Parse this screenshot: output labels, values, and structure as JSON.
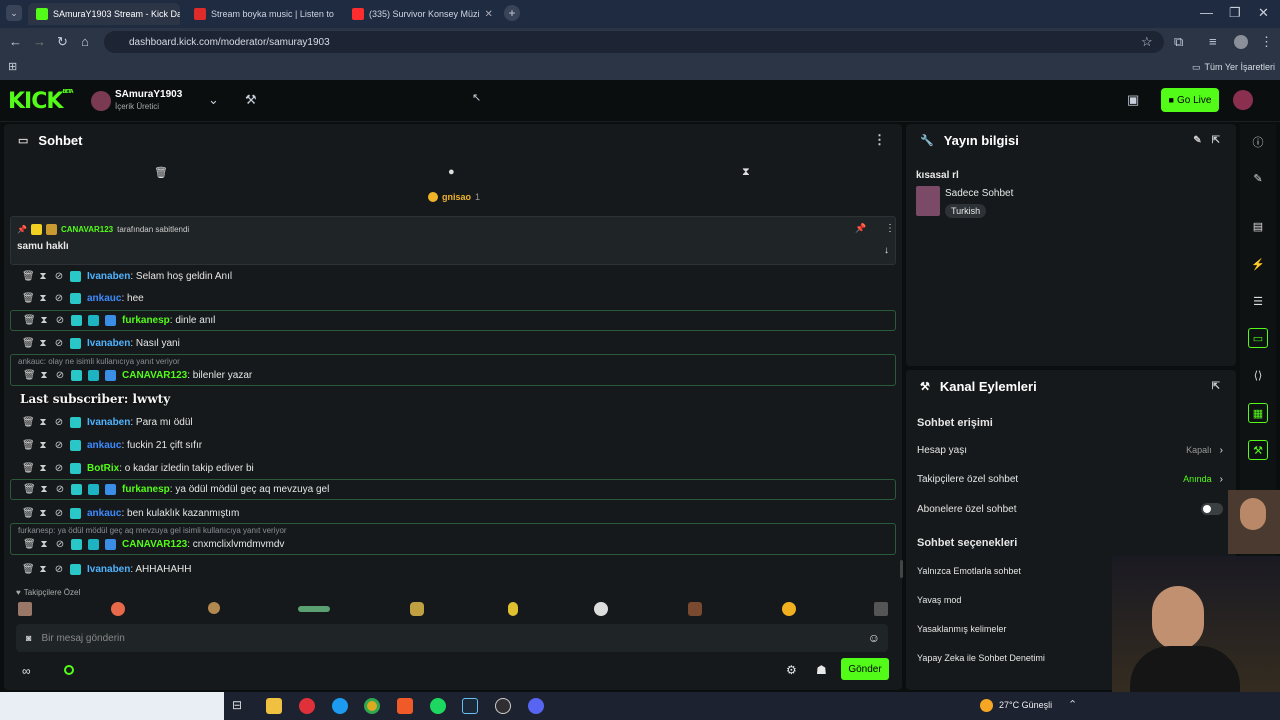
{
  "browser": {
    "tabs": [
      {
        "title": "SAmuraY1903 Stream - Kick Da",
        "color": "#53fc18"
      },
      {
        "title": "Stream boyka music | Listen to",
        "color": "#e02b2b"
      },
      {
        "title": "(335) Survivor Konsey Müzi",
        "color": "#ff2d2d"
      }
    ],
    "url": "dashboard.kick.com/moderator/samuray1903",
    "bookmarks_label": "Tüm Yer İşaretleri"
  },
  "header": {
    "logo": "KICK",
    "beta": "BETA",
    "username": "SAmuraY1903",
    "role": "İçerik Üretici",
    "golive_label": "Go Live"
  },
  "chat": {
    "title": "Sohbet",
    "top_user": "gnisao",
    "top_count": "1",
    "pinned": {
      "by": "CANAVAR123",
      "by_suffix": "tarafından sabitlendi",
      "text": "samu haklı"
    },
    "messages": [
      {
        "user": "Ivanaben",
        "text": ": Selam hoş geldin Anıl",
        "color": "#4fb3ff",
        "hl": false
      },
      {
        "user": "ankauc",
        "text": ": hee",
        "color": "#3d8bff",
        "hl": false
      },
      {
        "user": "furkanesp",
        "text": ": dinle anıl",
        "color": "#53fc18",
        "hl": true
      },
      {
        "user": "Ivanaben",
        "text": ": Nasıl yani",
        "color": "#4fb3ff",
        "hl": false
      },
      {
        "user": "CANAVAR123",
        "text": ": bilenler yazar",
        "color": "#53fc18",
        "hl": true,
        "reply": "ankauc: olay ne isimli kullanıcıya yanıt veriyor"
      },
      {
        "user": "Ivanaben",
        "text": ": Para mı ödül",
        "color": "#4fb3ff",
        "hl": false
      },
      {
        "user": "ankauc",
        "text": ": fuckin 21 çift sıfır",
        "color": "#3d8bff",
        "hl": false
      },
      {
        "user": "BotRix",
        "text": ": o kadar izledin takip ediver bi",
        "color": "#53fc18",
        "hl": false
      },
      {
        "user": "furkanesp",
        "text": ": ya ödül mödül geç aq mevzuya gel",
        "color": "#53fc18",
        "hl": true
      },
      {
        "user": "ankauc",
        "text": ": ben kulaklık kazanmıştım",
        "color": "#3d8bff",
        "hl": false
      },
      {
        "user": "CANAVAR123",
        "text": ": cnxmclixlvmdmvmdv",
        "color": "#53fc18",
        "hl": true,
        "reply": "furkanesp: ya ödül mödül geç aq mevzuya gel isimli kullanıcıya yanıt veriyor"
      },
      {
        "user": "Ivanaben",
        "text": ": AHHAHAHH",
        "color": "#4fb3ff",
        "hl": false
      }
    ],
    "overlay_text": "Last subscriber: lwwty",
    "followers_only": "Takipçilere Özel",
    "input_placeholder": "Bir mesaj gönderin",
    "send_label": "Gönder"
  },
  "stream_info": {
    "title": "Yayın bilgisi",
    "stream_title": "kısasal rl",
    "category": "Sadece Sohbet",
    "language": "Turkish"
  },
  "channel_actions": {
    "title": "Kanal Eylemleri",
    "section1": "Sohbet erişimi",
    "rows": [
      {
        "label": "Hesap yaşı",
        "value": "Kapalı"
      },
      {
        "label": "Takipçilere özel sohbet",
        "value": "Anında"
      },
      {
        "label": "Abonelere özel sohbet",
        "value": ""
      }
    ],
    "section2": "Sohbet seçenekleri",
    "options": [
      "Yalnızca Emotlarla sohbet",
      "Yavaş mod",
      "Yasaklanmış kelimeler",
      "Yapay Zeka ile Sohbet Denetimi"
    ]
  },
  "taskbar": {
    "weather": "27°C Güneşli"
  }
}
